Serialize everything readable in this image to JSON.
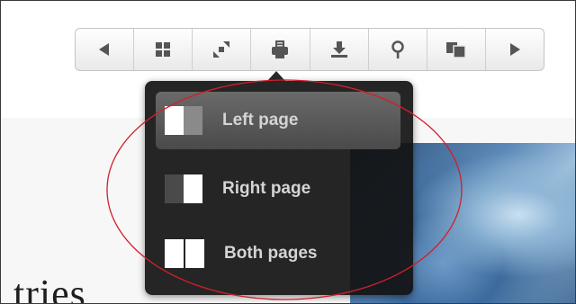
{
  "toolbar": {
    "buttons": [
      {
        "name": "previous-page",
        "icon": "arrow-left-icon"
      },
      {
        "name": "thumbnails",
        "icon": "grid-icon"
      },
      {
        "name": "fullscreen",
        "icon": "expand-icon"
      },
      {
        "name": "print",
        "icon": "printer-icon"
      },
      {
        "name": "download",
        "icon": "download-icon"
      },
      {
        "name": "search",
        "icon": "search-icon"
      },
      {
        "name": "page-view",
        "icon": "pages-icon"
      },
      {
        "name": "next-page",
        "icon": "arrow-right-icon"
      }
    ]
  },
  "print_menu": {
    "items": [
      {
        "label": "Left page",
        "icon": "left-page-icon",
        "selected": true
      },
      {
        "label": "Right page",
        "icon": "right-page-icon",
        "selected": false
      },
      {
        "label": "Both pages",
        "icon": "both-pages-icon",
        "selected": false
      }
    ]
  },
  "background_page": {
    "text_fragment": "tries"
  },
  "colors": {
    "menu_bg": "#121212",
    "menu_text": "#d4d4d4",
    "annotation_ellipse": "#d0202a",
    "icon": "#555555"
  }
}
